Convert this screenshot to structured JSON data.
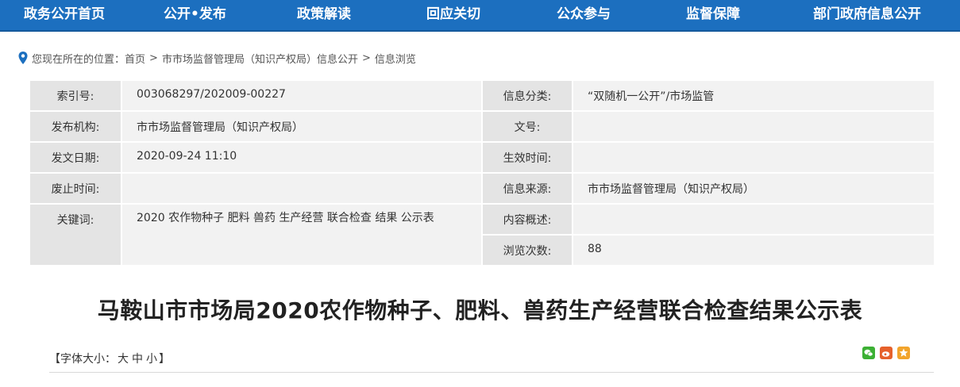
{
  "nav": {
    "items": [
      {
        "label": "政务公开首页"
      },
      {
        "label": "公开•发布"
      },
      {
        "label": "政策解读"
      },
      {
        "label": "回应关切"
      },
      {
        "label": "公众参与"
      },
      {
        "label": "监督保障"
      },
      {
        "label": "部门政府信息公开"
      }
    ],
    "background": "#1c6fbf"
  },
  "breadcrumb": {
    "prefix": "您现在所在的位置：",
    "items": [
      "首页",
      "市市场监督管理局（知识产权局）信息公开",
      "信息浏览"
    ],
    "separator": ">"
  },
  "info_table": {
    "index_no": {
      "label": "索引号:",
      "value": "003068297/202009-00227"
    },
    "category": {
      "label": "信息分类:",
      "value": "“双随机一公开”/市场监管"
    },
    "publisher": {
      "label": "发布机构:",
      "value": "市市场监督管理局（知识产权局）"
    },
    "doc_no": {
      "label": "文号:",
      "value": ""
    },
    "issue_date": {
      "label": "发文日期:",
      "value": "2020-09-24 11:10"
    },
    "effective_time": {
      "label": "生效时间:",
      "value": ""
    },
    "repeal_time": {
      "label": "废止时间:",
      "value": ""
    },
    "source": {
      "label": "信息来源:",
      "value": "市市场监督管理局（知识产权局）"
    },
    "keywords": {
      "label": "关键词:",
      "value": "2020  农作物种子  肥料  兽药  生产经营  联合检查  结果  公示表"
    },
    "summary": {
      "label": "内容概述:",
      "value": ""
    },
    "views": {
      "label": "浏览次数:",
      "value": "88"
    }
  },
  "article": {
    "title": "马鞍山市市场局2020农作物种子、肥料、兽药生产经营联合检查结果公示表"
  },
  "font_size": {
    "prefix": "【字体大小：",
    "large": "大",
    "medium": "中",
    "small": "小",
    "suffix": "】"
  },
  "share": {
    "icons": [
      "wechat-icon",
      "weibo-icon",
      "favorite-icon"
    ],
    "colors": {
      "wechat": "#3cb034",
      "weibo": "#e6612b",
      "favorite": "#f2a42b"
    }
  }
}
